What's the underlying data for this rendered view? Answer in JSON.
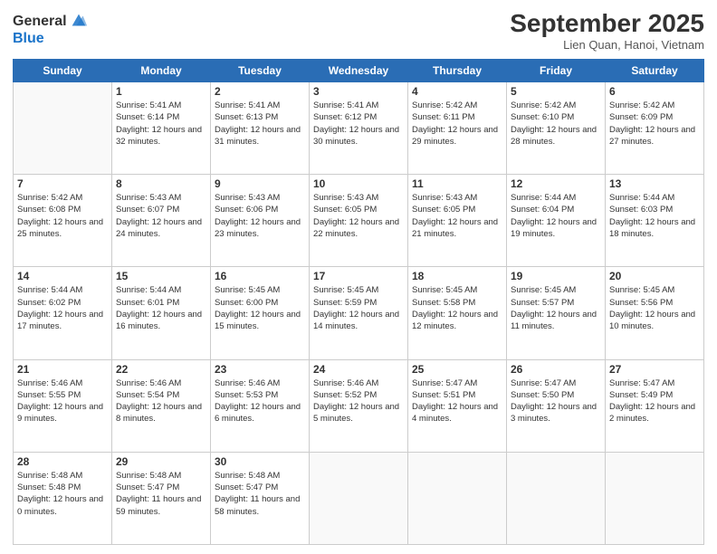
{
  "logo": {
    "general": "General",
    "blue": "Blue"
  },
  "header": {
    "month": "September 2025",
    "location": "Lien Quan, Hanoi, Vietnam"
  },
  "weekdays": [
    "Sunday",
    "Monday",
    "Tuesday",
    "Wednesday",
    "Thursday",
    "Friday",
    "Saturday"
  ],
  "weeks": [
    [
      {
        "day": "",
        "sunrise": "",
        "sunset": "",
        "daylight": ""
      },
      {
        "day": "1",
        "sunrise": "Sunrise: 5:41 AM",
        "sunset": "Sunset: 6:14 PM",
        "daylight": "Daylight: 12 hours and 32 minutes."
      },
      {
        "day": "2",
        "sunrise": "Sunrise: 5:41 AM",
        "sunset": "Sunset: 6:13 PM",
        "daylight": "Daylight: 12 hours and 31 minutes."
      },
      {
        "day": "3",
        "sunrise": "Sunrise: 5:41 AM",
        "sunset": "Sunset: 6:12 PM",
        "daylight": "Daylight: 12 hours and 30 minutes."
      },
      {
        "day": "4",
        "sunrise": "Sunrise: 5:42 AM",
        "sunset": "Sunset: 6:11 PM",
        "daylight": "Daylight: 12 hours and 29 minutes."
      },
      {
        "day": "5",
        "sunrise": "Sunrise: 5:42 AM",
        "sunset": "Sunset: 6:10 PM",
        "daylight": "Daylight: 12 hours and 28 minutes."
      },
      {
        "day": "6",
        "sunrise": "Sunrise: 5:42 AM",
        "sunset": "Sunset: 6:09 PM",
        "daylight": "Daylight: 12 hours and 27 minutes."
      }
    ],
    [
      {
        "day": "7",
        "sunrise": "Sunrise: 5:42 AM",
        "sunset": "Sunset: 6:08 PM",
        "daylight": "Daylight: 12 hours and 25 minutes."
      },
      {
        "day": "8",
        "sunrise": "Sunrise: 5:43 AM",
        "sunset": "Sunset: 6:07 PM",
        "daylight": "Daylight: 12 hours and 24 minutes."
      },
      {
        "day": "9",
        "sunrise": "Sunrise: 5:43 AM",
        "sunset": "Sunset: 6:06 PM",
        "daylight": "Daylight: 12 hours and 23 minutes."
      },
      {
        "day": "10",
        "sunrise": "Sunrise: 5:43 AM",
        "sunset": "Sunset: 6:05 PM",
        "daylight": "Daylight: 12 hours and 22 minutes."
      },
      {
        "day": "11",
        "sunrise": "Sunrise: 5:43 AM",
        "sunset": "Sunset: 6:05 PM",
        "daylight": "Daylight: 12 hours and 21 minutes."
      },
      {
        "day": "12",
        "sunrise": "Sunrise: 5:44 AM",
        "sunset": "Sunset: 6:04 PM",
        "daylight": "Daylight: 12 hours and 19 minutes."
      },
      {
        "day": "13",
        "sunrise": "Sunrise: 5:44 AM",
        "sunset": "Sunset: 6:03 PM",
        "daylight": "Daylight: 12 hours and 18 minutes."
      }
    ],
    [
      {
        "day": "14",
        "sunrise": "Sunrise: 5:44 AM",
        "sunset": "Sunset: 6:02 PM",
        "daylight": "Daylight: 12 hours and 17 minutes."
      },
      {
        "day": "15",
        "sunrise": "Sunrise: 5:44 AM",
        "sunset": "Sunset: 6:01 PM",
        "daylight": "Daylight: 12 hours and 16 minutes."
      },
      {
        "day": "16",
        "sunrise": "Sunrise: 5:45 AM",
        "sunset": "Sunset: 6:00 PM",
        "daylight": "Daylight: 12 hours and 15 minutes."
      },
      {
        "day": "17",
        "sunrise": "Sunrise: 5:45 AM",
        "sunset": "Sunset: 5:59 PM",
        "daylight": "Daylight: 12 hours and 14 minutes."
      },
      {
        "day": "18",
        "sunrise": "Sunrise: 5:45 AM",
        "sunset": "Sunset: 5:58 PM",
        "daylight": "Daylight: 12 hours and 12 minutes."
      },
      {
        "day": "19",
        "sunrise": "Sunrise: 5:45 AM",
        "sunset": "Sunset: 5:57 PM",
        "daylight": "Daylight: 12 hours and 11 minutes."
      },
      {
        "day": "20",
        "sunrise": "Sunrise: 5:45 AM",
        "sunset": "Sunset: 5:56 PM",
        "daylight": "Daylight: 12 hours and 10 minutes."
      }
    ],
    [
      {
        "day": "21",
        "sunrise": "Sunrise: 5:46 AM",
        "sunset": "Sunset: 5:55 PM",
        "daylight": "Daylight: 12 hours and 9 minutes."
      },
      {
        "day": "22",
        "sunrise": "Sunrise: 5:46 AM",
        "sunset": "Sunset: 5:54 PM",
        "daylight": "Daylight: 12 hours and 8 minutes."
      },
      {
        "day": "23",
        "sunrise": "Sunrise: 5:46 AM",
        "sunset": "Sunset: 5:53 PM",
        "daylight": "Daylight: 12 hours and 6 minutes."
      },
      {
        "day": "24",
        "sunrise": "Sunrise: 5:46 AM",
        "sunset": "Sunset: 5:52 PM",
        "daylight": "Daylight: 12 hours and 5 minutes."
      },
      {
        "day": "25",
        "sunrise": "Sunrise: 5:47 AM",
        "sunset": "Sunset: 5:51 PM",
        "daylight": "Daylight: 12 hours and 4 minutes."
      },
      {
        "day": "26",
        "sunrise": "Sunrise: 5:47 AM",
        "sunset": "Sunset: 5:50 PM",
        "daylight": "Daylight: 12 hours and 3 minutes."
      },
      {
        "day": "27",
        "sunrise": "Sunrise: 5:47 AM",
        "sunset": "Sunset: 5:49 PM",
        "daylight": "Daylight: 12 hours and 2 minutes."
      }
    ],
    [
      {
        "day": "28",
        "sunrise": "Sunrise: 5:48 AM",
        "sunset": "Sunset: 5:48 PM",
        "daylight": "Daylight: 12 hours and 0 minutes."
      },
      {
        "day": "29",
        "sunrise": "Sunrise: 5:48 AM",
        "sunset": "Sunset: 5:47 PM",
        "daylight": "Daylight: 11 hours and 59 minutes."
      },
      {
        "day": "30",
        "sunrise": "Sunrise: 5:48 AM",
        "sunset": "Sunset: 5:47 PM",
        "daylight": "Daylight: 11 hours and 58 minutes."
      },
      {
        "day": "",
        "sunrise": "",
        "sunset": "",
        "daylight": ""
      },
      {
        "day": "",
        "sunrise": "",
        "sunset": "",
        "daylight": ""
      },
      {
        "day": "",
        "sunrise": "",
        "sunset": "",
        "daylight": ""
      },
      {
        "day": "",
        "sunrise": "",
        "sunset": "",
        "daylight": ""
      }
    ]
  ]
}
